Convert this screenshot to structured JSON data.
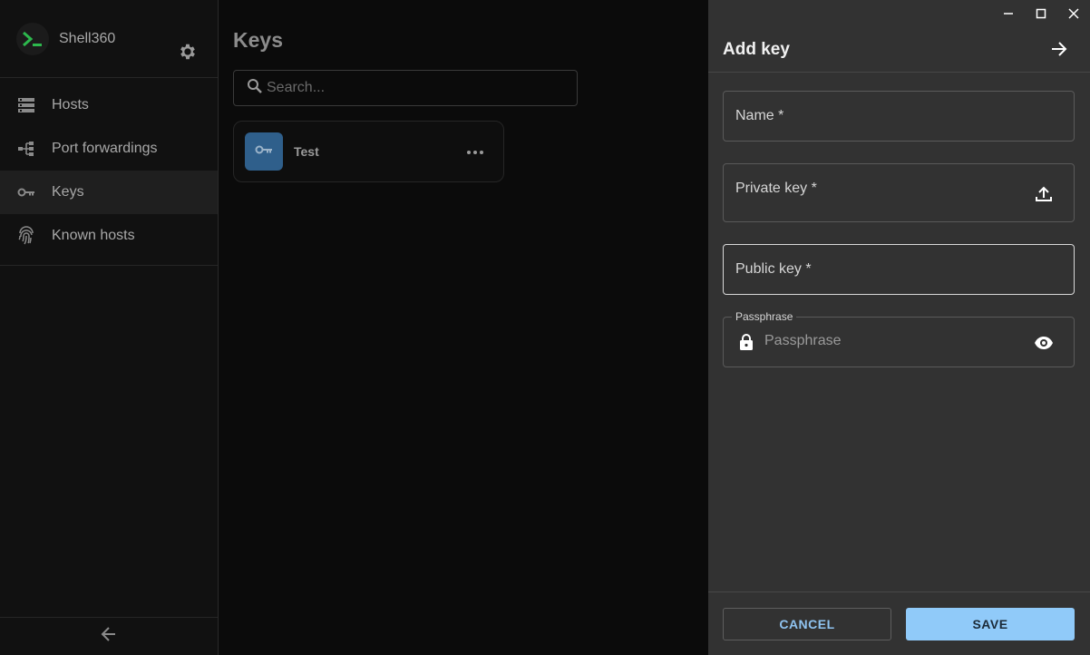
{
  "app": {
    "name": "Shell360",
    "accent": "#90caf9",
    "logo_color": "#2db84d"
  },
  "sidebar": {
    "items": [
      {
        "label": "Hosts",
        "icon": "server-icon",
        "active": false
      },
      {
        "label": "Port forwardings",
        "icon": "port-forward-icon",
        "active": false
      },
      {
        "label": "Keys",
        "icon": "key-icon",
        "active": true
      },
      {
        "label": "Known hosts",
        "icon": "fingerprint-icon",
        "active": false
      }
    ]
  },
  "main": {
    "title": "Keys",
    "search": {
      "placeholder": "Search..."
    },
    "keys": [
      {
        "name": "Test"
      }
    ]
  },
  "panel": {
    "title": "Add key",
    "fields": {
      "name": {
        "label": "Name *"
      },
      "private_key": {
        "label": "Private key *"
      },
      "public_key": {
        "label": "Public key *"
      },
      "passphrase": {
        "legend": "Passphrase",
        "placeholder": "Passphrase"
      }
    },
    "buttons": {
      "cancel": "CANCEL",
      "save": "SAVE"
    }
  }
}
